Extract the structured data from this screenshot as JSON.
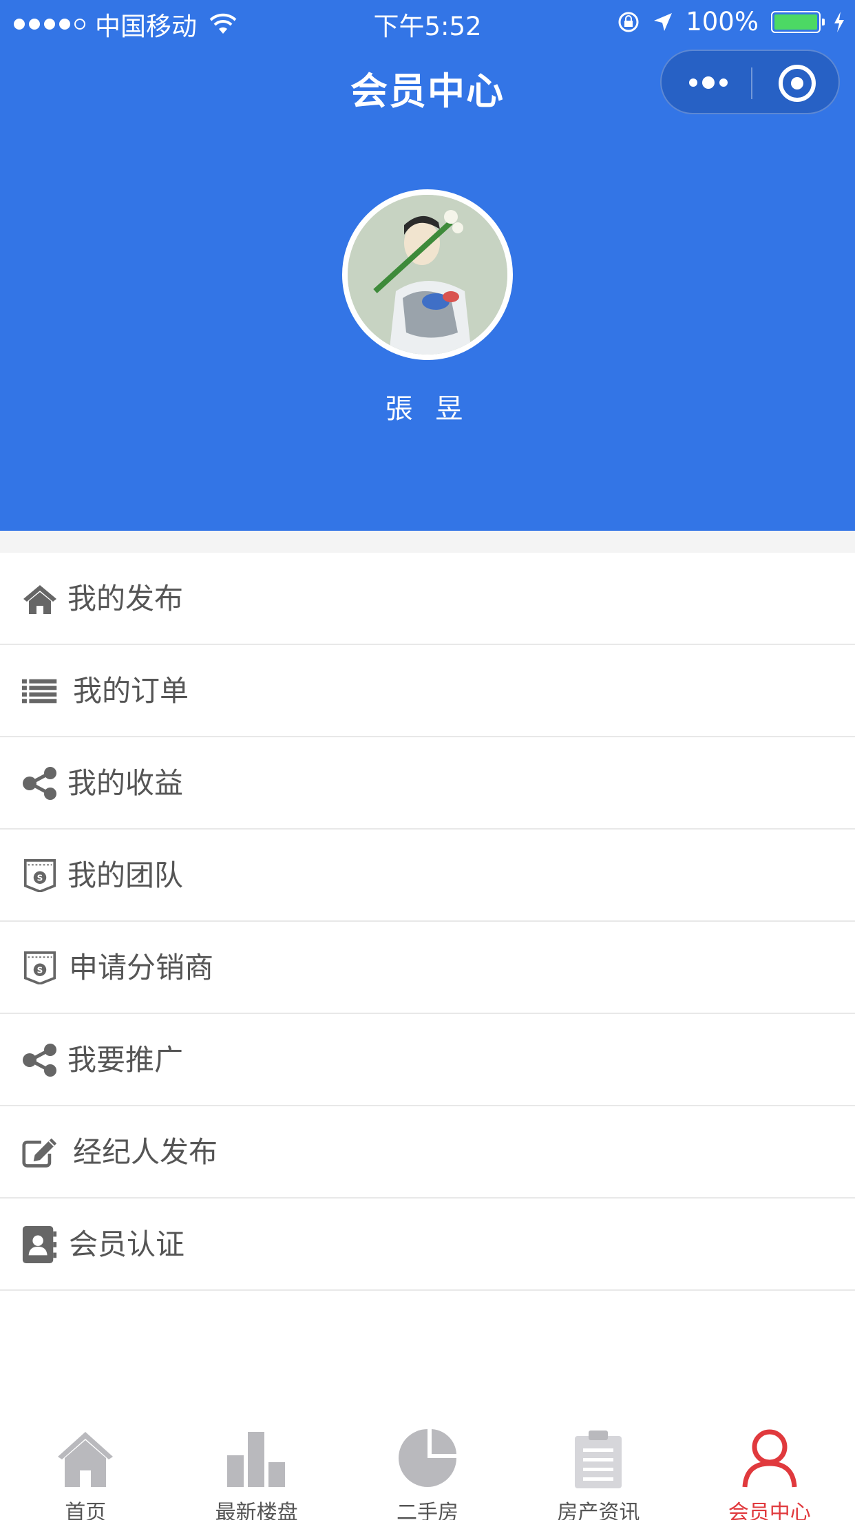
{
  "status_bar": {
    "carrier": "中国移动",
    "time": "下午5:52",
    "battery": "100%"
  },
  "nav": {
    "title": "会员中心"
  },
  "profile": {
    "name": "張 昱"
  },
  "menu": {
    "items": [
      {
        "label": "我的发布",
        "icon": "home-icon"
      },
      {
        "label": "我的订单",
        "icon": "list-icon"
      },
      {
        "label": "我的收益",
        "icon": "share-icon"
      },
      {
        "label": "我的团队",
        "icon": "badge-icon"
      },
      {
        "label": "申请分销商",
        "icon": "badge-icon"
      },
      {
        "label": "我要推广",
        "icon": "share-icon"
      },
      {
        "label": "经纪人发布",
        "icon": "edit-icon"
      },
      {
        "label": "会员认证",
        "icon": "contact-card-icon"
      }
    ]
  },
  "tabbar": {
    "tabs": [
      {
        "label": "首页",
        "icon": "home-icon"
      },
      {
        "label": "最新楼盘",
        "icon": "bar-chart-icon"
      },
      {
        "label": "二手房",
        "icon": "pie-chart-icon"
      },
      {
        "label": "房产资讯",
        "icon": "clipboard-icon"
      },
      {
        "label": "会员中心",
        "icon": "user-icon"
      }
    ],
    "active_index": 4
  },
  "colors": {
    "header_bg": "#3375e6",
    "active_tab": "#e0393d",
    "icon_gray": "#666666",
    "tab_icon_gray": "#b9b9bd"
  }
}
